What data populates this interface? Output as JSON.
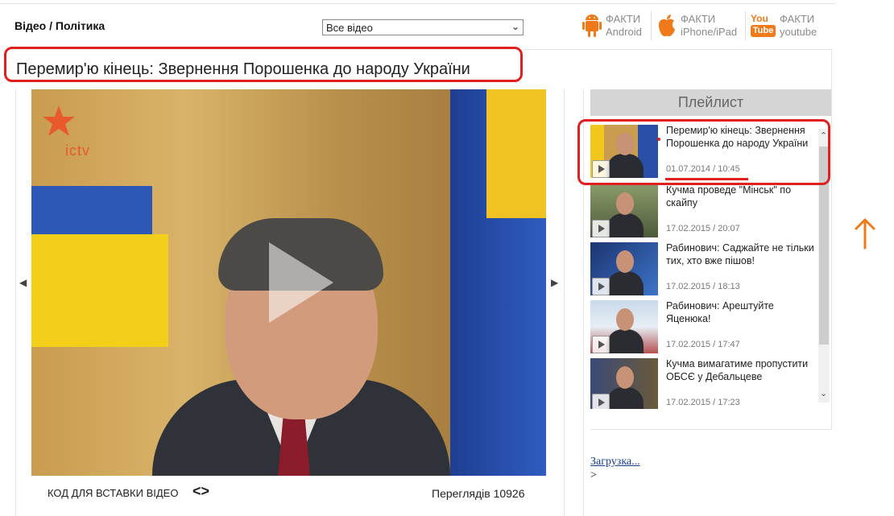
{
  "breadcrumb": "Відео / Політика",
  "video_filter": {
    "selected": "Все відео"
  },
  "apps": [
    {
      "name": "android",
      "line1": "ФАКТИ",
      "line2": "Android",
      "icon": "android-icon"
    },
    {
      "name": "iphone",
      "line1": "ФАКТИ",
      "line2": "iPhone/iPad",
      "icon": "apple-icon"
    },
    {
      "name": "youtube",
      "line1": "ФАКТИ",
      "line2": "youtube",
      "icon": "youtube-icon",
      "badge_top": "You",
      "badge_bottom": "Tube"
    }
  ],
  "page_title": "Перемир'ю кінець: Звернення Порошенка до народу України",
  "video": {
    "logo_text": "ictv",
    "play_icon": "play-icon"
  },
  "embed_label": "КОД ДЛЯ ВСТАВКИ ВІДЕО",
  "embed_icon": "<>",
  "views": "Переглядів 10926",
  "playlist": {
    "header": "Плейлист",
    "items": [
      {
        "title": "Перемир'ю кінець: Звернення Порошенка до народу України",
        "date": "01.07.2014 / 10:45"
      },
      {
        "title": "Кучма проведе \"Мінськ\" по скайпу",
        "date": "17.02.2015 / 20:07"
      },
      {
        "title": "Рабинович: Саджайте не тільки тих, хто вже пішов!",
        "date": "17.02.2015 / 18:13"
      },
      {
        "title": "Рабинович: Арештуйте Яценюка!",
        "date": "17.02.2015 / 17:47"
      },
      {
        "title": "Кучма вимагатиме пропустити ОБСЄ у Дебальцеве",
        "date": "17.02.2015 / 17:23"
      }
    ]
  },
  "loading_link": "Загрузка...",
  "more_arrow": ">",
  "colors": {
    "accent": "#e02020",
    "orange": "#f07a1a",
    "link": "#1b3e8f"
  }
}
